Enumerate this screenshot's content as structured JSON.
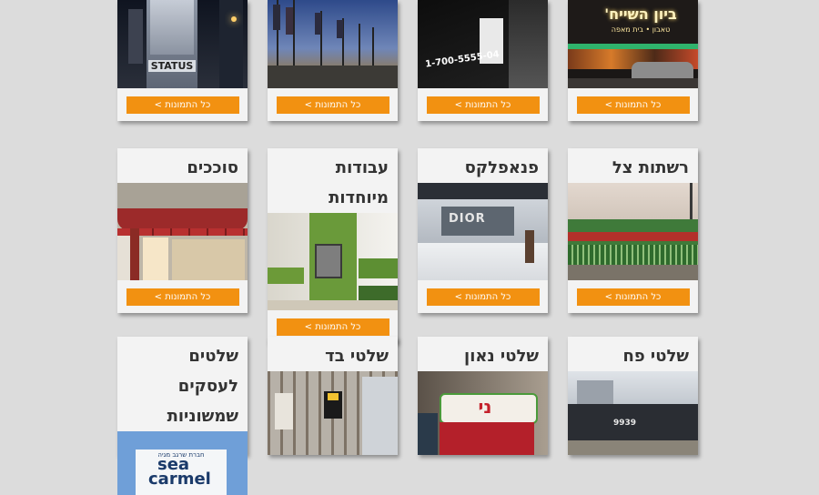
{
  "button_label": "כל התמונות >",
  "row1": [
    {
      "title": "",
      "image": "Status building sign at night"
    },
    {
      "title": "",
      "image": "Flags on poles at dusk"
    },
    {
      "title": "",
      "image": "Construction fence banner with phone number"
    },
    {
      "title": "",
      "image": "Illuminated store sign at night"
    }
  ],
  "row1_texts": {
    "status": "STATUS",
    "phone": "1-700-5555-04",
    "cafe": "ביון השייח'",
    "cafe_sub": "טאבון • בית מאפה"
  },
  "row2": [
    {
      "title": "סוככים",
      "image": "Red awning over shop front"
    },
    {
      "title": "עבודות מיוחדות",
      "image": "Green wall display sign"
    },
    {
      "title": "פנאפלקס",
      "image": "Dior store interior with backdrop"
    },
    {
      "title": "רשתות צל",
      "image": "Shade netting on fence"
    }
  ],
  "row2_texts": {
    "dior": "DIOR"
  },
  "row3": [
    {
      "title": "שלטים לעסקים שמשוניות",
      "image": "Sea Carmel sign"
    },
    {
      "title": "שלטי בד",
      "image": "Fabric banner on scaffolding"
    },
    {
      "title": "שלטי נאון",
      "image": "Neon sign on storefront"
    },
    {
      "title": "שלטי פח",
      "image": "Metal sign on fence"
    }
  ],
  "row3_texts": {
    "sea_top": "חברת שרגב מגיה",
    "sea": "sea",
    "carmel": "carmel",
    "phone2": "9939"
  },
  "colors": {
    "button": "#f29111",
    "background": "#dcdcdc",
    "card": "#f3f3f3"
  }
}
